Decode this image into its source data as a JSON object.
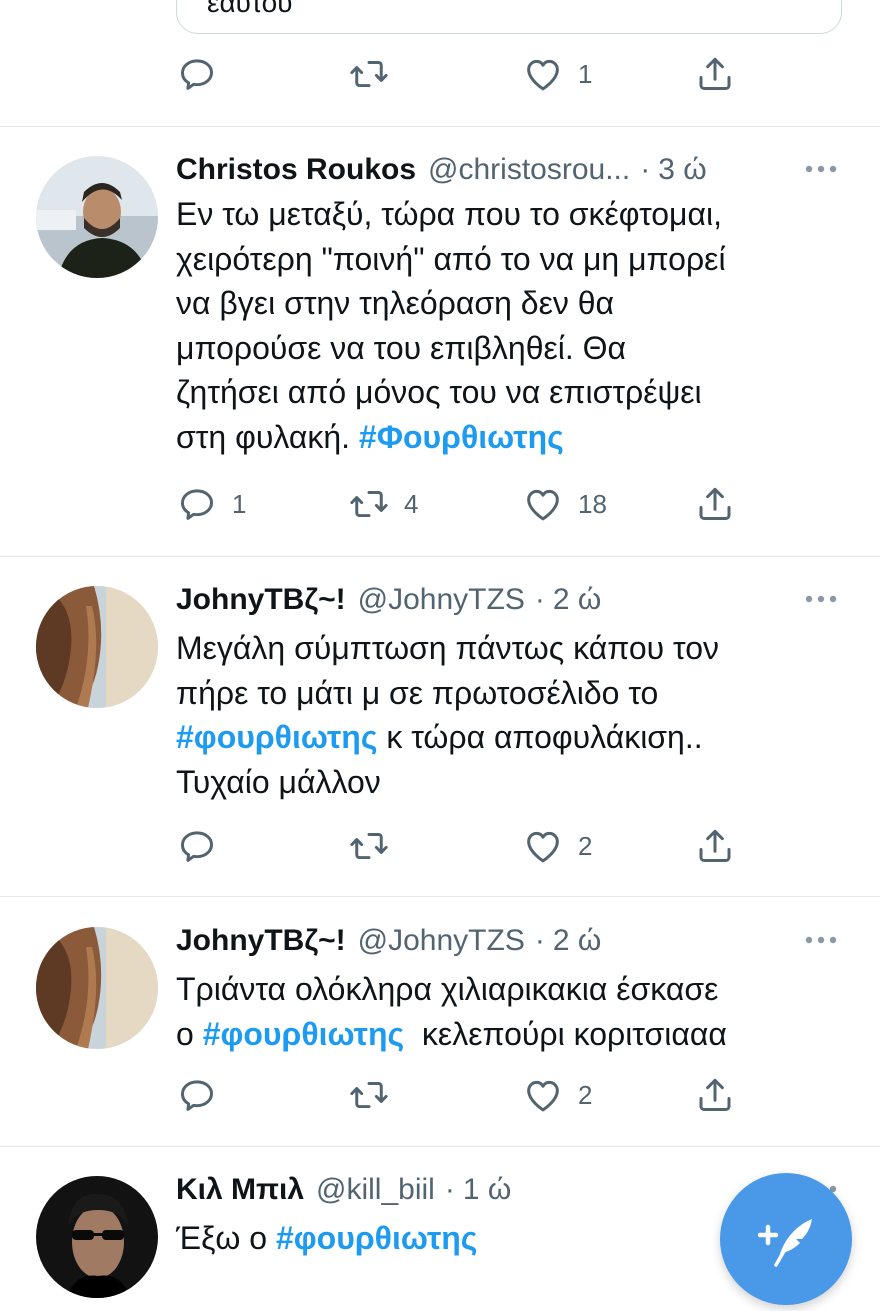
{
  "top_tweet": {
    "quote_text_partial": "εαυτού",
    "like_count": "1"
  },
  "tweets": [
    {
      "name": "Christos Roukos",
      "handle": "@christosrou...",
      "time": "3 ώ",
      "text_lines": [
        "Εν τω μεταξύ, τώρα που το σκέφτομαι,",
        "χειρότερη \"ποινή\" από το να μη μπορεί",
        "να βγει στην τηλεόραση δεν θα",
        "μπορούσε να του επιβληθεί. Θα",
        "ζητήσει από μόνος του να επιστρέψει"
      ],
      "last_line_prefix": "στη φυλακή. ",
      "last_line_tag": "#Φουρθιωτης",
      "reply_count": "1",
      "retweet_count": "4",
      "like_count": "18"
    },
    {
      "name": "JohnyTBζ~!",
      "handle": "@JohnyTZS",
      "time": "2 ώ",
      "line1": "Μεγάλη σύμπτωση πάντως κάπου τον",
      "line2": "πήρε το μάτι μ σε πρωτοσέλιδο το",
      "line3_tag": "#φουρθιωτης",
      "line3_suffix": " κ τώρα αποφυλάκιση..",
      "line4": "Τυχαίο μάλλον",
      "like_count": "2"
    },
    {
      "name": "JohnyTBζ~!",
      "handle": "@JohnyTZS",
      "time": "2 ώ",
      "line1": "Τριάντα ολόκληρα χιλιαρικακια έσκασε",
      "line2_prefix": "ο ",
      "line2_tag": "#φουρθιωτης",
      "line2_suffix": "  κελεπούρι κοριτσιααα",
      "like_count": "2"
    },
    {
      "name": "Κιλ Μπιλ",
      "handle": "@kill_biil",
      "time": "1 ώ",
      "line1_prefix": "Έξω ο ",
      "line1_tag": "#φουρθιωτης"
    }
  ],
  "separator": "·",
  "colors": {
    "accent": "#1d9bf0",
    "fab": "#4a99e9",
    "secondary_text": "#536471",
    "divider": "#e1e7ea"
  },
  "icons": [
    "reply-icon",
    "retweet-icon",
    "like-icon",
    "share-icon",
    "more-icon",
    "compose-tweet-icon"
  ]
}
